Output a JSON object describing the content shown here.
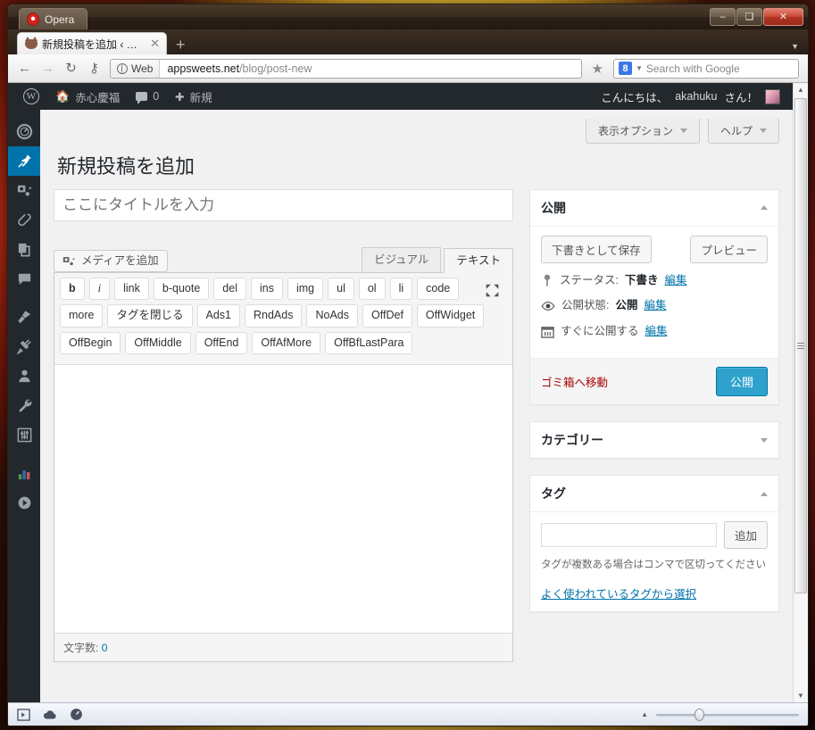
{
  "browser": {
    "app_name": "Opera",
    "window_controls": {
      "minimize": "–",
      "maximize": "❑",
      "close": "✕"
    },
    "tab": {
      "title": "新規投稿を追加 ‹ 赤...",
      "close": "✕",
      "favicon": "cat-favicon"
    },
    "new_tab_label": "+",
    "nav": {
      "back": "←",
      "forward": "→",
      "reload": "↻",
      "key": "⚷"
    },
    "address": {
      "badge_label": "Web",
      "host": "appsweets.net",
      "path": "/blog/post-new"
    },
    "bookmark_star": "★",
    "search": {
      "engine_letter": "8",
      "placeholder": "Search with Google"
    },
    "status_icons": [
      "panel-toggle-icon",
      "turbo-cloud-icon",
      "speed-gauge-icon"
    ],
    "zoom_percent": 100
  },
  "adminbar": {
    "logo": "wordpress-logo",
    "site_name": "赤心慶福",
    "comment_count": "0",
    "new_label": "新規",
    "greeting_prefix": "こんにちは、",
    "user_name": "akahuku",
    "greeting_suffix": "さん！"
  },
  "sidebar": {
    "items": [
      {
        "name": "dashboard",
        "icon": "gauge-icon",
        "current": false
      },
      {
        "name": "posts",
        "icon": "pin-icon",
        "current": true
      },
      {
        "name": "media",
        "icon": "media-icon",
        "current": false
      },
      {
        "name": "links",
        "icon": "paperclip-icon",
        "current": false
      },
      {
        "name": "pages",
        "icon": "pages-icon",
        "current": false
      },
      {
        "name": "comments",
        "icon": "comment-bubble-icon",
        "current": false
      },
      {
        "name": "appearance",
        "icon": "paintbrush-icon",
        "current": false
      },
      {
        "name": "plugins",
        "icon": "plug-icon",
        "current": false
      },
      {
        "name": "users",
        "icon": "user-icon",
        "current": false
      },
      {
        "name": "tools",
        "icon": "wrench-icon",
        "current": false
      },
      {
        "name": "settings",
        "icon": "sliders-icon",
        "current": false
      },
      {
        "name": "analytics",
        "icon": "bar-chart-icon",
        "current": false
      },
      {
        "name": "player",
        "icon": "play-circle-icon",
        "current": false
      }
    ]
  },
  "screen_meta": {
    "screen_options": "表示オプション",
    "help": "ヘルプ"
  },
  "main": {
    "page_title": "新規投稿を追加",
    "title_placeholder": "ここにタイトルを入力",
    "title_value": "",
    "add_media": "メディアを追加",
    "editor_tabs": [
      {
        "label": "ビジュアル",
        "active": false
      },
      {
        "label": "テキスト",
        "active": true
      }
    ],
    "quicktags_row1": [
      "b",
      "i",
      "link",
      "b-quote",
      "del",
      "ins",
      "img",
      "ul",
      "ol",
      "li",
      "code"
    ],
    "quicktags_row2": [
      "more",
      "タグを閉じる",
      "Ads1",
      "RndAds",
      "NoAds",
      "OffDef",
      "OffWidget"
    ],
    "quicktags_row3": [
      "OffBegin",
      "OffMiddle",
      "OffEnd",
      "OffAfMore",
      "OffBfLastPara"
    ],
    "fullscreen_icon": "expand-icon",
    "editor_content": "",
    "word_count_label": "文字数:",
    "word_count_value": "0"
  },
  "publish_box": {
    "title": "公開",
    "toggle_icon": "caret-up-icon",
    "save_draft": "下書きとして保存",
    "preview": "プレビュー",
    "status_label": "ステータス:",
    "status_value": "下書き",
    "status_edit": "編集",
    "visibility_label": "公開状態:",
    "visibility_value": "公開",
    "visibility_edit": "編集",
    "schedule_label": "すぐに公開する",
    "schedule_edit": "編集",
    "trash": "ゴミ箱へ移動",
    "publish": "公開"
  },
  "categories_box": {
    "title": "カテゴリー",
    "toggle_icon": "caret-down-icon"
  },
  "tags_box": {
    "title": "タグ",
    "toggle_icon": "caret-up-icon",
    "input_value": "",
    "add_button": "追加",
    "hint": "タグが複数ある場合はコンマで区切ってください",
    "choose_link": "よく使われているタグから選択"
  },
  "colors": {
    "admin_dark": "#23282d",
    "accent_blue": "#0073aa",
    "button_blue": "#2ea2cc",
    "link_blue": "#0073aa",
    "trash_red": "#a00000"
  }
}
